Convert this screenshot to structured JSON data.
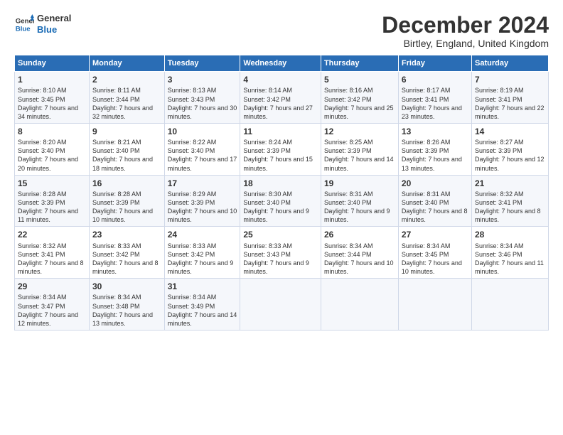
{
  "logo": {
    "line1": "General",
    "line2": "Blue"
  },
  "title": "December 2024",
  "subtitle": "Birtley, England, United Kingdom",
  "days_header": [
    "Sunday",
    "Monday",
    "Tuesday",
    "Wednesday",
    "Thursday",
    "Friday",
    "Saturday"
  ],
  "weeks": [
    [
      {
        "day": "1",
        "sunrise": "Sunrise: 8:10 AM",
        "sunset": "Sunset: 3:45 PM",
        "daylight": "Daylight: 7 hours and 34 minutes."
      },
      {
        "day": "2",
        "sunrise": "Sunrise: 8:11 AM",
        "sunset": "Sunset: 3:44 PM",
        "daylight": "Daylight: 7 hours and 32 minutes."
      },
      {
        "day": "3",
        "sunrise": "Sunrise: 8:13 AM",
        "sunset": "Sunset: 3:43 PM",
        "daylight": "Daylight: 7 hours and 30 minutes."
      },
      {
        "day": "4",
        "sunrise": "Sunrise: 8:14 AM",
        "sunset": "Sunset: 3:42 PM",
        "daylight": "Daylight: 7 hours and 27 minutes."
      },
      {
        "day": "5",
        "sunrise": "Sunrise: 8:16 AM",
        "sunset": "Sunset: 3:42 PM",
        "daylight": "Daylight: 7 hours and 25 minutes."
      },
      {
        "day": "6",
        "sunrise": "Sunrise: 8:17 AM",
        "sunset": "Sunset: 3:41 PM",
        "daylight": "Daylight: 7 hours and 23 minutes."
      },
      {
        "day": "7",
        "sunrise": "Sunrise: 8:19 AM",
        "sunset": "Sunset: 3:41 PM",
        "daylight": "Daylight: 7 hours and 22 minutes."
      }
    ],
    [
      {
        "day": "8",
        "sunrise": "Sunrise: 8:20 AM",
        "sunset": "Sunset: 3:40 PM",
        "daylight": "Daylight: 7 hours and 20 minutes."
      },
      {
        "day": "9",
        "sunrise": "Sunrise: 8:21 AM",
        "sunset": "Sunset: 3:40 PM",
        "daylight": "Daylight: 7 hours and 18 minutes."
      },
      {
        "day": "10",
        "sunrise": "Sunrise: 8:22 AM",
        "sunset": "Sunset: 3:40 PM",
        "daylight": "Daylight: 7 hours and 17 minutes."
      },
      {
        "day": "11",
        "sunrise": "Sunrise: 8:24 AM",
        "sunset": "Sunset: 3:39 PM",
        "daylight": "Daylight: 7 hours and 15 minutes."
      },
      {
        "day": "12",
        "sunrise": "Sunrise: 8:25 AM",
        "sunset": "Sunset: 3:39 PM",
        "daylight": "Daylight: 7 hours and 14 minutes."
      },
      {
        "day": "13",
        "sunrise": "Sunrise: 8:26 AM",
        "sunset": "Sunset: 3:39 PM",
        "daylight": "Daylight: 7 hours and 13 minutes."
      },
      {
        "day": "14",
        "sunrise": "Sunrise: 8:27 AM",
        "sunset": "Sunset: 3:39 PM",
        "daylight": "Daylight: 7 hours and 12 minutes."
      }
    ],
    [
      {
        "day": "15",
        "sunrise": "Sunrise: 8:28 AM",
        "sunset": "Sunset: 3:39 PM",
        "daylight": "Daylight: 7 hours and 11 minutes."
      },
      {
        "day": "16",
        "sunrise": "Sunrise: 8:28 AM",
        "sunset": "Sunset: 3:39 PM",
        "daylight": "Daylight: 7 hours and 10 minutes."
      },
      {
        "day": "17",
        "sunrise": "Sunrise: 8:29 AM",
        "sunset": "Sunset: 3:39 PM",
        "daylight": "Daylight: 7 hours and 10 minutes."
      },
      {
        "day": "18",
        "sunrise": "Sunrise: 8:30 AM",
        "sunset": "Sunset: 3:40 PM",
        "daylight": "Daylight: 7 hours and 9 minutes."
      },
      {
        "day": "19",
        "sunrise": "Sunrise: 8:31 AM",
        "sunset": "Sunset: 3:40 PM",
        "daylight": "Daylight: 7 hours and 9 minutes."
      },
      {
        "day": "20",
        "sunrise": "Sunrise: 8:31 AM",
        "sunset": "Sunset: 3:40 PM",
        "daylight": "Daylight: 7 hours and 8 minutes."
      },
      {
        "day": "21",
        "sunrise": "Sunrise: 8:32 AM",
        "sunset": "Sunset: 3:41 PM",
        "daylight": "Daylight: 7 hours and 8 minutes."
      }
    ],
    [
      {
        "day": "22",
        "sunrise": "Sunrise: 8:32 AM",
        "sunset": "Sunset: 3:41 PM",
        "daylight": "Daylight: 7 hours and 8 minutes."
      },
      {
        "day": "23",
        "sunrise": "Sunrise: 8:33 AM",
        "sunset": "Sunset: 3:42 PM",
        "daylight": "Daylight: 7 hours and 8 minutes."
      },
      {
        "day": "24",
        "sunrise": "Sunrise: 8:33 AM",
        "sunset": "Sunset: 3:42 PM",
        "daylight": "Daylight: 7 hours and 9 minutes."
      },
      {
        "day": "25",
        "sunrise": "Sunrise: 8:33 AM",
        "sunset": "Sunset: 3:43 PM",
        "daylight": "Daylight: 7 hours and 9 minutes."
      },
      {
        "day": "26",
        "sunrise": "Sunrise: 8:34 AM",
        "sunset": "Sunset: 3:44 PM",
        "daylight": "Daylight: 7 hours and 10 minutes."
      },
      {
        "day": "27",
        "sunrise": "Sunrise: 8:34 AM",
        "sunset": "Sunset: 3:45 PM",
        "daylight": "Daylight: 7 hours and 10 minutes."
      },
      {
        "day": "28",
        "sunrise": "Sunrise: 8:34 AM",
        "sunset": "Sunset: 3:46 PM",
        "daylight": "Daylight: 7 hours and 11 minutes."
      }
    ],
    [
      {
        "day": "29",
        "sunrise": "Sunrise: 8:34 AM",
        "sunset": "Sunset: 3:47 PM",
        "daylight": "Daylight: 7 hours and 12 minutes."
      },
      {
        "day": "30",
        "sunrise": "Sunrise: 8:34 AM",
        "sunset": "Sunset: 3:48 PM",
        "daylight": "Daylight: 7 hours and 13 minutes."
      },
      {
        "day": "31",
        "sunrise": "Sunrise: 8:34 AM",
        "sunset": "Sunset: 3:49 PM",
        "daylight": "Daylight: 7 hours and 14 minutes."
      },
      null,
      null,
      null,
      null
    ]
  ]
}
